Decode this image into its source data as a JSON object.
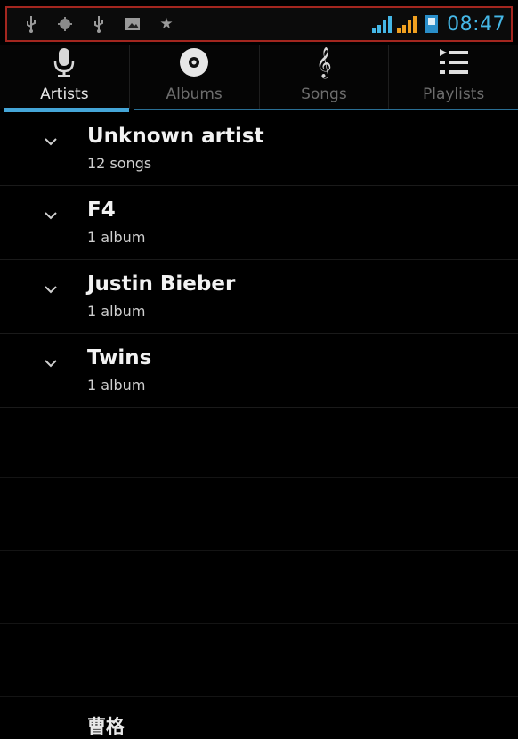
{
  "status_bar": {
    "icons_left": [
      "usb-icon",
      "android-debug-icon",
      "usb-icon",
      "image-icon",
      "star-icon"
    ],
    "time": "08:47"
  },
  "tabs": [
    {
      "label": "Artists",
      "icon": "microphone-icon",
      "active": true
    },
    {
      "label": "Albums",
      "icon": "disc-icon",
      "active": false
    },
    {
      "label": "Songs",
      "icon": "treble-clef-icon",
      "active": false
    },
    {
      "label": "Playlists",
      "icon": "playlist-icon",
      "active": false
    }
  ],
  "artists": [
    {
      "name": "Unknown artist",
      "detail": "12 songs"
    },
    {
      "name": "F4",
      "detail": "1 album"
    },
    {
      "name": "Justin Bieber",
      "detail": "1 album"
    },
    {
      "name": "Twins",
      "detail": "1 album"
    }
  ],
  "bottom_item": {
    "name": "曹格"
  },
  "colors": {
    "accent": "#45a6d8",
    "status_border": "#a3261f",
    "clock": "#45b7e6"
  }
}
